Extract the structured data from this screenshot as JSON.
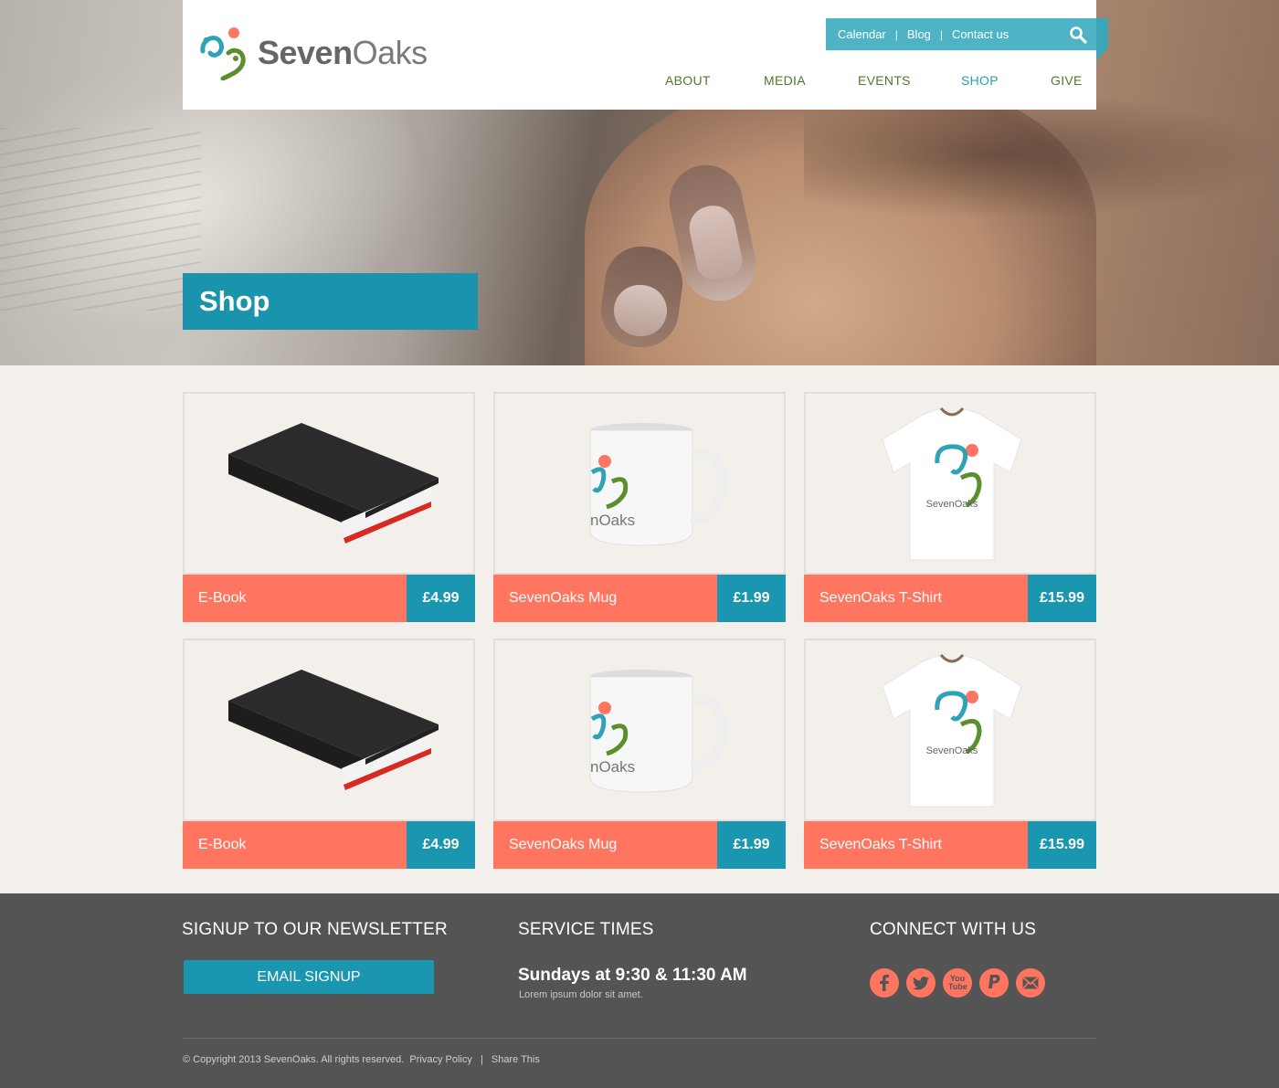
{
  "brand": {
    "name_bold": "Seven",
    "name_light": "Oaks"
  },
  "topbar": {
    "links": [
      "Calendar",
      "Blog",
      "Contact us"
    ],
    "search_icon": "search-icon"
  },
  "nav": {
    "items": [
      "ABOUT",
      "MEDIA",
      "EVENTS",
      "SHOP",
      "GIVE"
    ],
    "active": "SHOP"
  },
  "hero": {
    "title": "Shop"
  },
  "products": [
    {
      "name": "E-Book",
      "price": "£4.99",
      "image": "book"
    },
    {
      "name": "SevenOaks Mug",
      "price": "£1.99",
      "image": "mug"
    },
    {
      "name": "SevenOaks T-Shirt",
      "price": "£15.99",
      "image": "tshirt"
    },
    {
      "name": "E-Book",
      "price": "£4.99",
      "image": "book"
    },
    {
      "name": "SevenOaks Mug",
      "price": "£1.99",
      "image": "mug"
    },
    {
      "name": "SevenOaks T-Shirt",
      "price": "£15.99",
      "image": "tshirt"
    }
  ],
  "product_print": {
    "mug_text": "nOaks",
    "shirt_text": "SevenOaks"
  },
  "footer": {
    "newsletter": {
      "heading": "SIGNUP TO OUR NEWSLETTER",
      "button": "EMAIL SIGNUP"
    },
    "service": {
      "heading": "SERVICE TIMES",
      "times": "Sundays at 9:30 & 11:30 AM",
      "note": "Lorem ipsum dolor sit amet."
    },
    "connect": {
      "heading": "CONNECT WITH US",
      "icons": [
        "facebook-icon",
        "twitter-icon",
        "youtube-icon",
        "paypal-icon",
        "email-icon"
      ],
      "youtube_label": "You Tube"
    },
    "copyright": "© Copyright 2013 SevenOaks. All rights reserved.",
    "privacy": "Privacy Policy",
    "share": "Share This"
  },
  "colors": {
    "teal": "#1a96b0",
    "topbar": "#4eb4c5",
    "coral": "#ff7560",
    "nav_green": "#4f7a2a",
    "footer": "#545454",
    "content_bg": "#f3efea"
  }
}
